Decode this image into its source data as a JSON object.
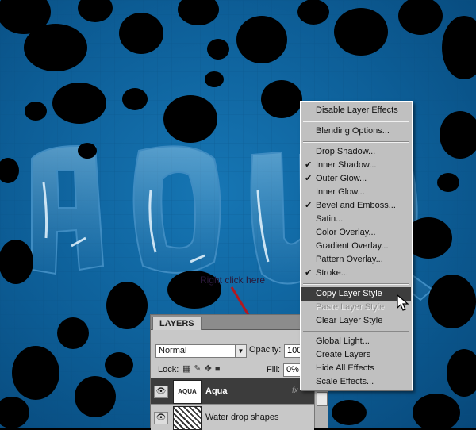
{
  "annotation": {
    "text": "Right click here"
  },
  "layers_panel": {
    "tab_label": "LAYERS",
    "blend_mode": "Normal",
    "opacity_label": "Opacity:",
    "opacity_value": "100%",
    "lock_label": "Lock:",
    "fill_label": "Fill:",
    "fill_value": "0%",
    "layers": [
      {
        "name": "Aqua",
        "thumb_text": "AQUA",
        "selected": true
      },
      {
        "name": "Water drop shapes",
        "selected": false
      }
    ]
  },
  "context_menu": {
    "items": [
      {
        "label": "Disable Layer Effects"
      },
      {
        "label": "Blending Options..."
      },
      {
        "label": "Drop Shadow..."
      },
      {
        "label": "Inner Shadow...",
        "checked": true
      },
      {
        "label": "Outer Glow...",
        "checked": true
      },
      {
        "label": "Inner Glow..."
      },
      {
        "label": "Bevel and Emboss...",
        "checked": true
      },
      {
        "label": "Satin..."
      },
      {
        "label": "Color Overlay..."
      },
      {
        "label": "Gradient Overlay..."
      },
      {
        "label": "Pattern Overlay..."
      },
      {
        "label": "Stroke...",
        "checked": true
      },
      {
        "label": "Copy Layer Style",
        "highlighted": true
      },
      {
        "label": "Paste Layer Style",
        "disabled": true
      },
      {
        "label": "Clear Layer Style"
      },
      {
        "label": "Global Light..."
      },
      {
        "label": "Create Layers"
      },
      {
        "label": "Hide All Effects"
      },
      {
        "label": "Scale Effects..."
      }
    ]
  },
  "colors": {
    "canvas_blue": "#0d5e97",
    "menu_bg": "#c0c0c0",
    "menu_highlight": "#3d3d3d",
    "arrow_red": "#b3181e"
  }
}
